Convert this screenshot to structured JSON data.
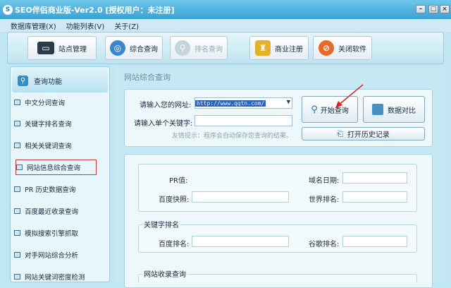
{
  "window": {
    "title": "SEO伴侣商业版-Ver2.0 [授权用户：未注册]",
    "logo_text": "S"
  },
  "menu": [
    "数据库管理(X)",
    "功能列表(V)",
    "关于(Z)"
  ],
  "toolbar": {
    "site_manage": "站点管理",
    "combined_query": "综合查询",
    "rank_query": "排名查询",
    "register": "商业注册",
    "close": "关闭软件"
  },
  "sidebar": {
    "header": "查询功能",
    "items": [
      "中文分词查询",
      "关键字排名查询",
      "相关关键词查询",
      "网站信息综合查询",
      "PR 历史数据查询",
      "百度最近收录查询",
      "模拟搜索引擎抓取",
      "对手网站综合分析",
      "网站关键词密度检测"
    ]
  },
  "main": {
    "title": "网站综合查询",
    "url_label": "请输入您的网址:",
    "url_value": "http://www.qqtn.com/",
    "keyword_label": "请输入单个关键字:",
    "keyword_value": "",
    "tip": "友情提示：程序会自动保存您查询的结果。",
    "start_button": "开始查询",
    "compare_button": "数据对比",
    "history_button": "打开历史记录"
  },
  "results": {
    "pr_label": "PR值:",
    "domain_date_label": "域名日期:",
    "baidu_snapshot_label": "百度快照:",
    "world_rank_label": "世界排名:",
    "keyword_rank_group": "关键字排名",
    "baidu_rank_label": "百度排名:",
    "google_rank_label": "谷歌排名:",
    "index_group": "网站收录查询"
  }
}
